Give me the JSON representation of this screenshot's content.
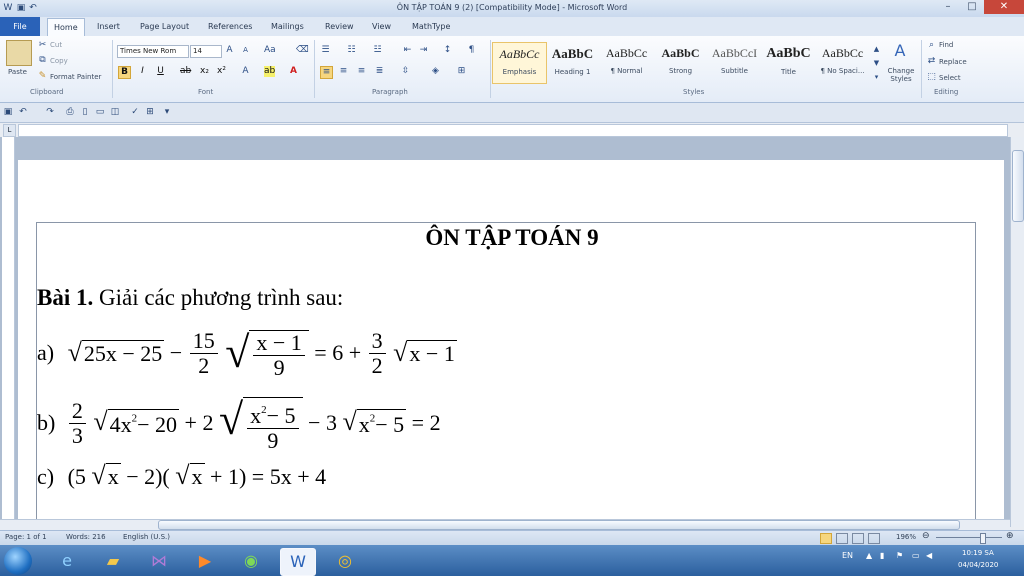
{
  "window": {
    "title": "ÔN TẬP TOÁN 9 (2) [Compatibility Mode] - Microsoft Word",
    "min_glyph": "–",
    "max_glyph": "□",
    "close_glyph": "✕"
  },
  "tabs": [
    "File",
    "Home",
    "Insert",
    "Page Layout",
    "References",
    "Mailings",
    "Review",
    "View",
    "MathType"
  ],
  "clipboard": {
    "paste": "Paste",
    "cut": "Cut",
    "copy": "Copy",
    "format_painter": "Format Painter",
    "group": "Clipboard"
  },
  "font": {
    "name": "Times New Rom",
    "size": "14",
    "group": "Font"
  },
  "paragraph": {
    "group": "Paragraph"
  },
  "styles": {
    "group": "Styles",
    "items": [
      {
        "sample": "AaBbCc",
        "name": "Emphasis"
      },
      {
        "sample": "AaBbC",
        "name": "Heading 1"
      },
      {
        "sample": "AaBbCc",
        "name": "¶ Normal"
      },
      {
        "sample": "AaBbC",
        "name": "Strong"
      },
      {
        "sample": "AaBbCcI",
        "name": "Subtitle"
      },
      {
        "sample": "AaBbC",
        "name": "Title"
      },
      {
        "sample": "AaBbCc",
        "name": "¶ No Spaci..."
      }
    ],
    "change_styles": "Change Styles"
  },
  "editing": {
    "group": "Editing",
    "find": "Find",
    "replace": "Replace",
    "select": "Select"
  },
  "document": {
    "title": "ÔN TẬP TOÁN 9",
    "exercise_bold": "Bài 1.",
    "exercise_text": " Giải các phương trình sau:",
    "eq_a": {
      "label": "a)",
      "t1": "25x − 25",
      "minus": "−",
      "f1_num": "15",
      "f1_den": "2",
      "f2_num": "x − 1",
      "f2_den": "9",
      "rhs1": "= 6 +",
      "f3_num": "3",
      "f3_den": "2",
      "t2": "x − 1"
    },
    "eq_b": {
      "label": "b)",
      "f1_num": "2",
      "f1_den": "3",
      "t1": "4x",
      "t1_sup": "2",
      "t1_rest": " − 20",
      "plus2": "+ 2",
      "f2_num": "x",
      "f2_sup": "2",
      "f2_rest": " − 5",
      "f2_den": "9",
      "minus3": "− 3",
      "t2": "x",
      "t2_sup": "2",
      "t2_rest": " − 5",
      "rhs": "= 2"
    },
    "eq_c": {
      "label": "c)",
      "open": "(5",
      "x1": "x",
      "mid": "− 2)(",
      "x2": "x",
      "close": "+ 1) = 5x + 4"
    }
  },
  "status": {
    "page": "Page: 1 of 1",
    "words": "Words: 216",
    "language": "English (U.S.)",
    "zoom": "196%"
  },
  "tray": {
    "lang": "EN",
    "time": "10:19 SA",
    "date": "04/04/2020"
  }
}
